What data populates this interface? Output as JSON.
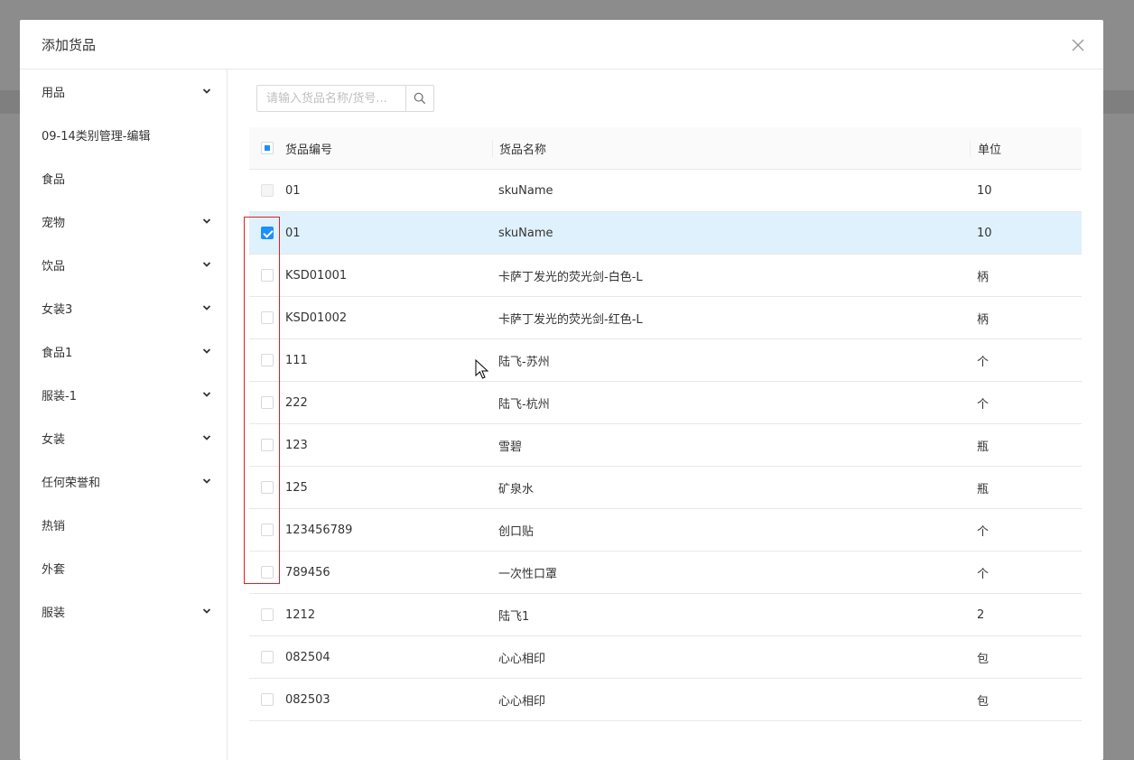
{
  "dialog": {
    "title": "添加货品"
  },
  "sidebar": {
    "items": [
      {
        "label": "用品",
        "expandable": true
      },
      {
        "label": "09-14类别管理-编辑",
        "expandable": false
      },
      {
        "label": "食品",
        "expandable": false
      },
      {
        "label": "宠物",
        "expandable": true
      },
      {
        "label": "饮品",
        "expandable": true
      },
      {
        "label": "女装3",
        "expandable": true
      },
      {
        "label": "食品1",
        "expandable": true
      },
      {
        "label": "服装-1",
        "expandable": true
      },
      {
        "label": "女装",
        "expandable": true
      },
      {
        "label": "任何荣誉和",
        "expandable": true
      },
      {
        "label": "热销",
        "expandable": false
      },
      {
        "label": "外套",
        "expandable": false
      },
      {
        "label": "服装",
        "expandable": true
      }
    ]
  },
  "search": {
    "placeholder": "请输入货品名称/货号..."
  },
  "table": {
    "columns": [
      "货品编号",
      "货品名称",
      "单位"
    ],
    "header_check_state": "indeterminate",
    "rows": [
      {
        "code": "01",
        "name": "skuName",
        "unit": "10",
        "state": "disabled"
      },
      {
        "code": "01",
        "name": "skuName",
        "unit": "10",
        "state": "checked"
      },
      {
        "code": "KSD01001",
        "name": "卡萨丁发光的荧光剑-白色-L",
        "unit": "柄",
        "state": "unchecked"
      },
      {
        "code": "KSD01002",
        "name": "卡萨丁发光的荧光剑-红色-L",
        "unit": "柄",
        "state": "unchecked"
      },
      {
        "code": "111",
        "name": "陆飞-苏州",
        "unit": "个",
        "state": "unchecked"
      },
      {
        "code": "222",
        "name": "陆飞-杭州",
        "unit": "个",
        "state": "unchecked"
      },
      {
        "code": "123",
        "name": "雪碧",
        "unit": "瓶",
        "state": "unchecked"
      },
      {
        "code": "125",
        "name": "矿泉水",
        "unit": "瓶",
        "state": "unchecked"
      },
      {
        "code": "123456789",
        "name": "创口贴",
        "unit": "个",
        "state": "unchecked"
      },
      {
        "code": "789456",
        "name": "一次性口罩",
        "unit": "个",
        "state": "unchecked"
      },
      {
        "code": "1212",
        "name": "陆飞1",
        "unit": "2",
        "state": "unchecked"
      },
      {
        "code": "082504",
        "name": "心心相印",
        "unit": "包",
        "state": "unchecked"
      },
      {
        "code": "082503",
        "name": "心心相印",
        "unit": "包",
        "state": "unchecked"
      }
    ]
  },
  "colors": {
    "primary": "#1890ff",
    "selected_row": "#dff1fd",
    "highlight_box": "#e02020",
    "overlay": "#8c8c8c"
  }
}
